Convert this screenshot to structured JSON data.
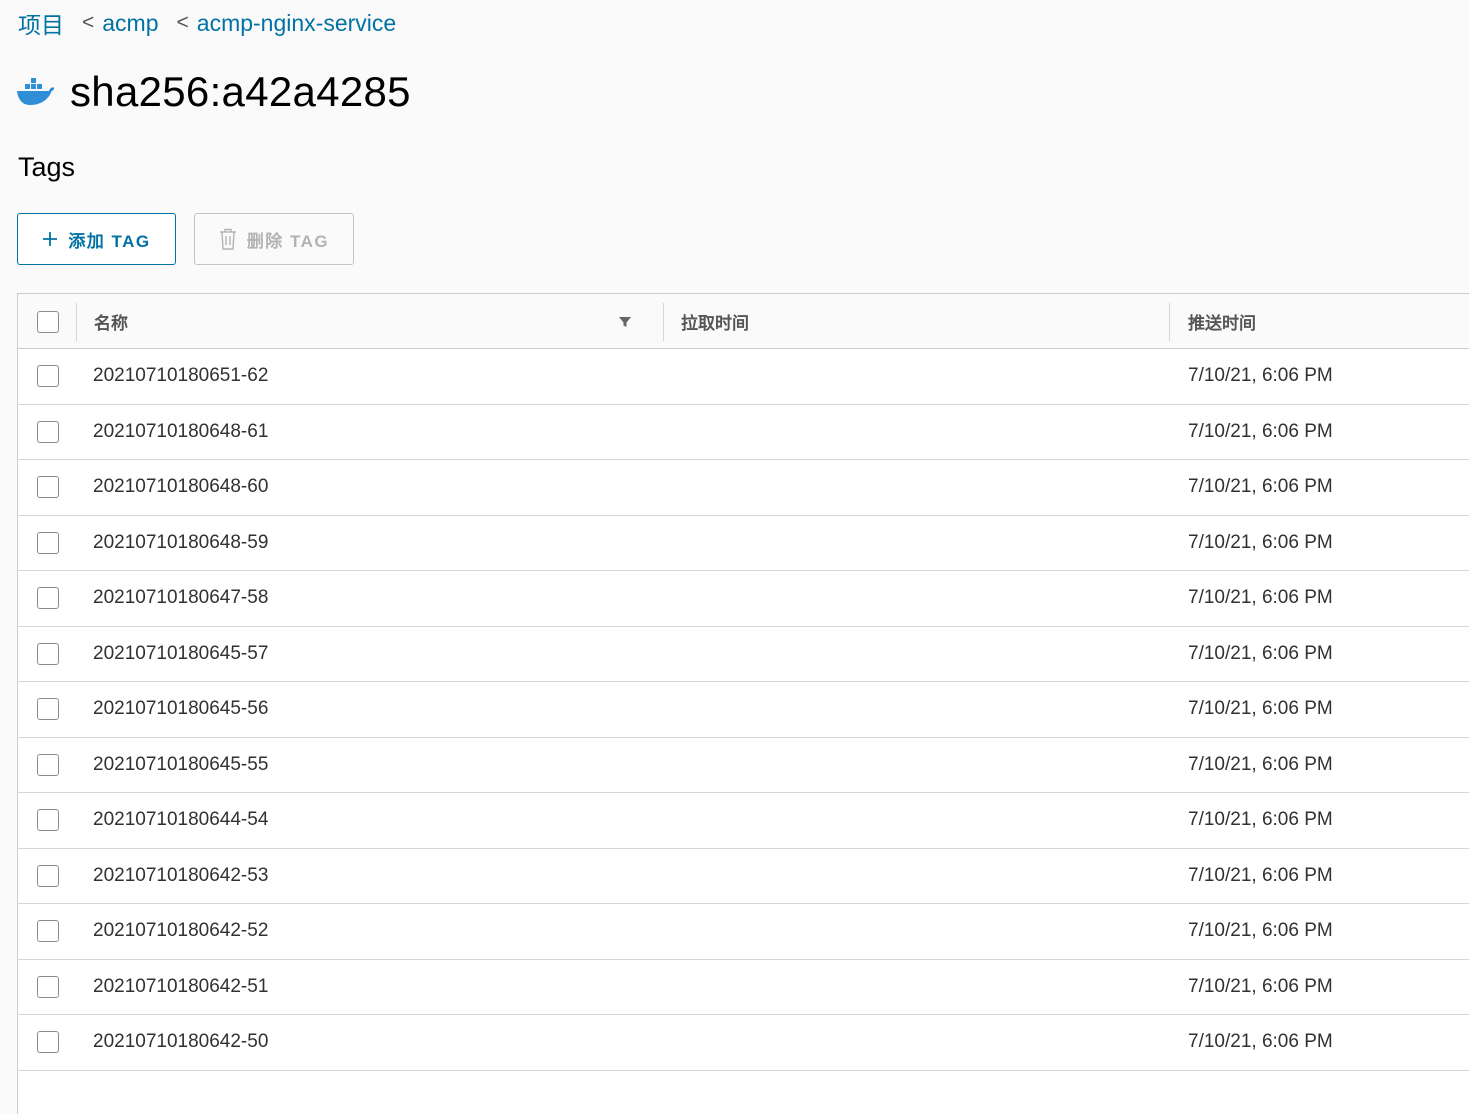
{
  "breadcrumb": {
    "items": [
      "项目",
      "acmp",
      "acmp-nginx-service"
    ],
    "separator": "<"
  },
  "header": {
    "icon": "docker-icon",
    "title": "sha256:a42a4285"
  },
  "section": {
    "title": "Tags"
  },
  "toolbar": {
    "add_label": "添加 TAG",
    "delete_label": "删除 TAG"
  },
  "table": {
    "columns": [
      "名称",
      "拉取时间",
      "推送时间"
    ],
    "rows": [
      {
        "name": "20210710180651-62",
        "pull_time": "",
        "push_time": "7/10/21, 6:06 PM"
      },
      {
        "name": "20210710180648-61",
        "pull_time": "",
        "push_time": "7/10/21, 6:06 PM"
      },
      {
        "name": "20210710180648-60",
        "pull_time": "",
        "push_time": "7/10/21, 6:06 PM"
      },
      {
        "name": "20210710180648-59",
        "pull_time": "",
        "push_time": "7/10/21, 6:06 PM"
      },
      {
        "name": "20210710180647-58",
        "pull_time": "",
        "push_time": "7/10/21, 6:06 PM"
      },
      {
        "name": "20210710180645-57",
        "pull_time": "",
        "push_time": "7/10/21, 6:06 PM"
      },
      {
        "name": "20210710180645-56",
        "pull_time": "",
        "push_time": "7/10/21, 6:06 PM"
      },
      {
        "name": "20210710180645-55",
        "pull_time": "",
        "push_time": "7/10/21, 6:06 PM"
      },
      {
        "name": "20210710180644-54",
        "pull_time": "",
        "push_time": "7/10/21, 6:06 PM"
      },
      {
        "name": "20210710180642-53",
        "pull_time": "",
        "push_time": "7/10/21, 6:06 PM"
      },
      {
        "name": "20210710180642-52",
        "pull_time": "",
        "push_time": "7/10/21, 6:06 PM"
      },
      {
        "name": "20210710180642-51",
        "pull_time": "",
        "push_time": "7/10/21, 6:06 PM"
      },
      {
        "name": "20210710180642-50",
        "pull_time": "",
        "push_time": "7/10/21, 6:06 PM"
      }
    ]
  },
  "colors": {
    "link": "#0072a3",
    "docker_blue": "#2e8fd6",
    "border": "#cccccc",
    "disabled": "#b3b3b3"
  }
}
